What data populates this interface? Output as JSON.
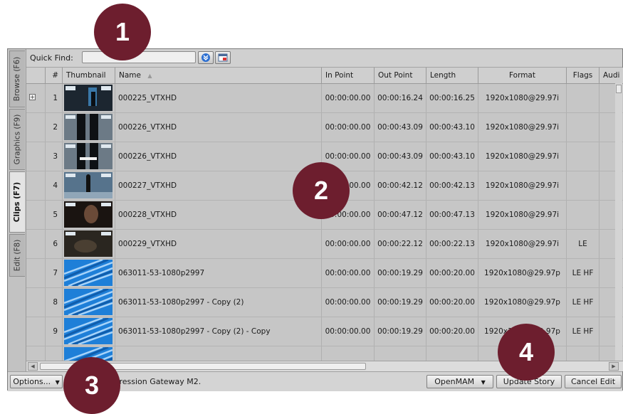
{
  "quick_find": {
    "label": "Quick Find:",
    "value": ""
  },
  "side_tabs": [
    "Browse (F6)",
    "Graphics (F9)",
    "Clips (F7)",
    "Edit (F8)"
  ],
  "columns": [
    "",
    "#",
    "Thumbnail",
    "Name",
    "In Point",
    "Out Point",
    "Length",
    "Format",
    "Flags",
    "Audi"
  ],
  "sort_indicator": "▲",
  "rows": [
    {
      "num": "1",
      "name": "000225_VTXHD",
      "in": "00:00:00.00",
      "out": "00:00:16.24",
      "length": "00:00:16.25",
      "format": "1920x1080@29.97i",
      "flags": "",
      "thumb": "dark-studio",
      "expandable": true
    },
    {
      "num": "2",
      "name": "000226_VTXHD",
      "in": "00:00:00.00",
      "out": "00:00:43.09",
      "length": "00:00:43.10",
      "format": "1920x1080@29.97i",
      "flags": "",
      "thumb": "legs"
    },
    {
      "num": "3",
      "name": "000226_VTXHD",
      "in": "00:00:00.00",
      "out": "00:00:43.09",
      "length": "00:00:43.10",
      "format": "1920x1080@29.97i",
      "flags": "",
      "thumb": "legs-title"
    },
    {
      "num": "4",
      "name": "000227_VTXHD",
      "in": "00:00:00.00",
      "out": "00:00:42.12",
      "length": "00:00:42.13",
      "format": "1920x1080@29.97i",
      "flags": "",
      "thumb": "figure"
    },
    {
      "num": "5",
      "name": "000228_VTXHD",
      "in": "00:00:00.00",
      "out": "00:00:47.12",
      "length": "00:00:47.13",
      "format": "1920x1080@29.97i",
      "flags": "",
      "thumb": "portrait"
    },
    {
      "num": "6",
      "name": "000229_VTXHD",
      "in": "00:00:00.00",
      "out": "00:00:22.12",
      "length": "00:00:22.13",
      "format": "1920x1080@29.97i",
      "flags": "LE",
      "thumb": "dark"
    },
    {
      "num": "7",
      "name": "063011-53-1080p2997",
      "in": "00:00:00.00",
      "out": "00:00:19.29",
      "length": "00:00:20.00",
      "format": "1920x1080@29.97p",
      "flags": "LE HF",
      "thumb": "blue"
    },
    {
      "num": "8",
      "name": "063011-53-1080p2997 - Copy (2)",
      "in": "00:00:00.00",
      "out": "00:00:19.29",
      "length": "00:00:20.00",
      "format": "1920x1080@29.97p",
      "flags": "LE HF",
      "thumb": "blue"
    },
    {
      "num": "9",
      "name": "063011-53-1080p2997 - Copy (2) - Copy",
      "in": "00:00:00.00",
      "out": "00:00:19.29",
      "length": "00:00:20.00",
      "format": "1920x1080@29.97p",
      "flags": "LE HF",
      "thumb": "blue"
    },
    {
      "num": "",
      "name": "",
      "in": "",
      "out": "",
      "length": "",
      "format": "",
      "flags": "",
      "thumb": "blue"
    }
  ],
  "bottom": {
    "options_label": "Options...",
    "status_text": "Pression Gateway M2.",
    "openmam_label": "OpenMAM",
    "update_story_label": "Update Story",
    "cancel_edit_label": "Cancel Edit"
  },
  "callouts": [
    "1",
    "2",
    "3",
    "4"
  ],
  "colors": {
    "callout": "#6d1e2e",
    "panel": "#c8c8c8",
    "thumb_blue": "#1e7fd8"
  }
}
